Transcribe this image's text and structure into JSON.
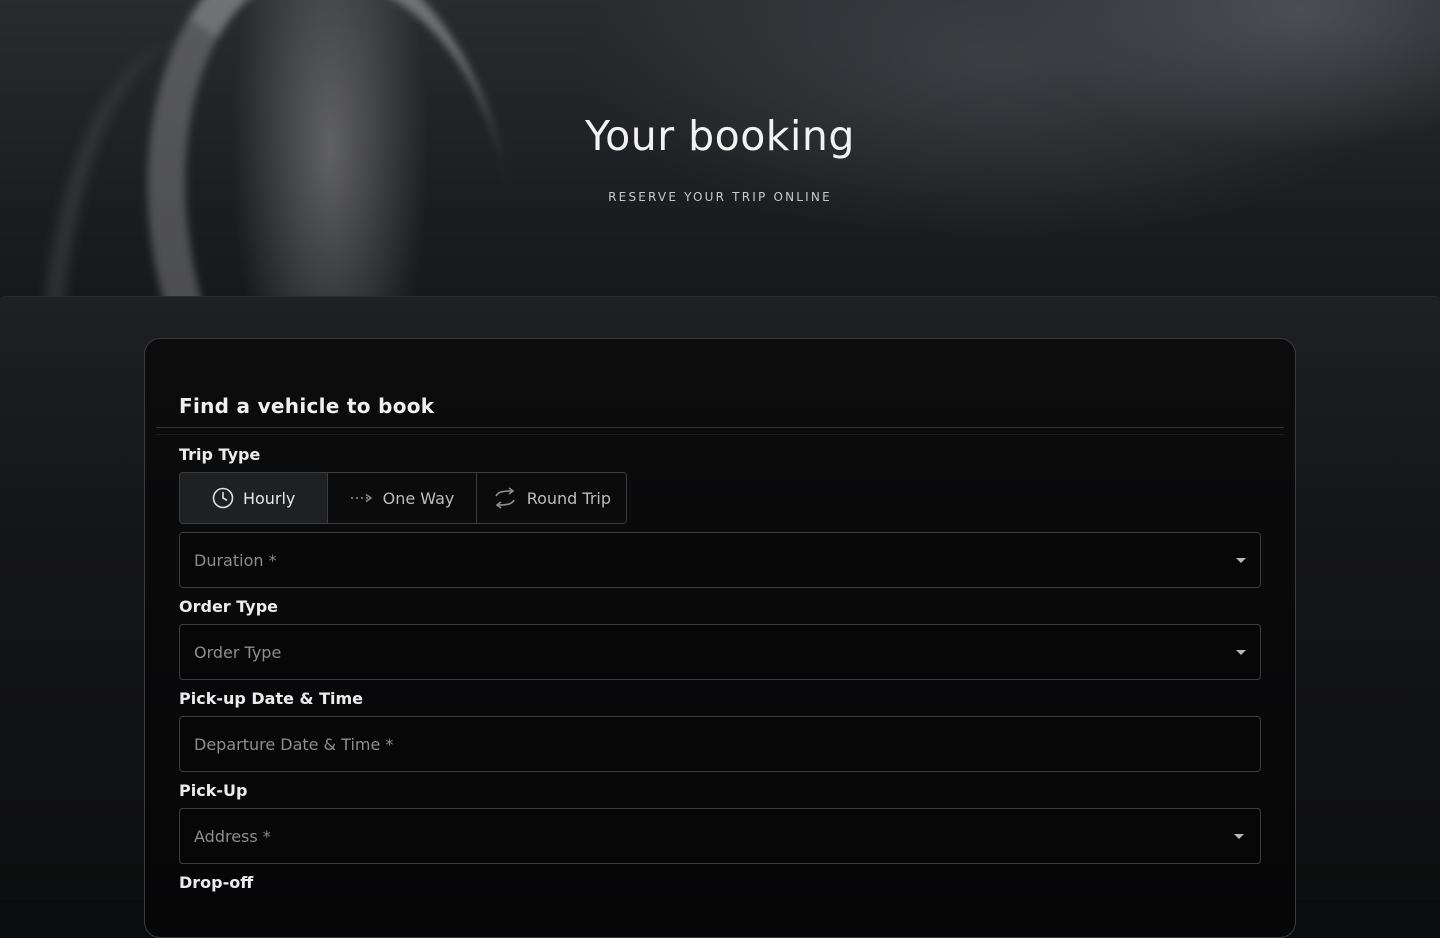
{
  "hero": {
    "title": "Your booking",
    "subtitle": "RESERVE YOUR TRIP ONLINE"
  },
  "card": {
    "title": "Find a vehicle to book"
  },
  "trip_type": {
    "label": "Trip Type",
    "tabs": [
      {
        "label": "Hourly",
        "icon": "clock-icon",
        "active": true
      },
      {
        "label": "One Way",
        "icon": "dashed-arrow-icon",
        "active": false
      },
      {
        "label": "Round Trip",
        "icon": "round-trip-icon",
        "active": false
      }
    ],
    "duration_placeholder": "Duration *"
  },
  "order_type": {
    "label": "Order Type",
    "placeholder": "Order Type"
  },
  "pickup_datetime": {
    "label": "Pick-up Date & Time",
    "placeholder": "Departure Date & Time *"
  },
  "pickup": {
    "label": "Pick-Up",
    "placeholder": "Address *"
  },
  "dropoff": {
    "label": "Drop-off"
  },
  "colors": {
    "background": "#0b0c0e",
    "border": "#3a3c40",
    "active_tab": "#1f2022",
    "text": "#e6e6e6",
    "placeholder": "#8d8d8f"
  }
}
